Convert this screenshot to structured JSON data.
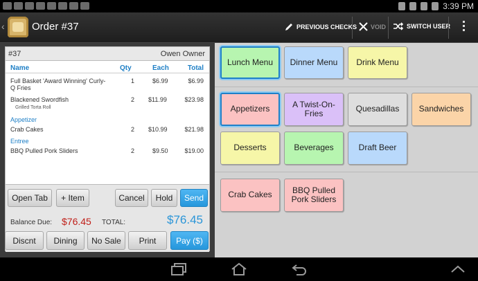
{
  "status": {
    "time": "3:39 PM",
    "notification_icons": [
      "usb-icon",
      "screenshot-icon",
      "play-store-icon",
      "play-store-icon",
      "play-store-icon",
      "play-store-icon",
      "play-store-icon",
      "play-store-icon"
    ],
    "system_icons": [
      "bluetooth-icon",
      "vibrate-icon",
      "wifi-icon",
      "battery-icon"
    ]
  },
  "actionbar": {
    "title": "Order #37",
    "previous_checks": "PREVIOUS CHECKS",
    "void": "VOID",
    "switch_user": "SWITCH USER"
  },
  "ticket": {
    "number": "#37",
    "owner": "Owen Owner",
    "columns": {
      "name": "Name",
      "qty": "Qty",
      "each": "Each",
      "total": "Total"
    },
    "items": [
      {
        "name": "Full Basket 'Award Winning' Curly-Q Fries",
        "qty": "1",
        "each": "$6.99",
        "total": "$6.99"
      },
      {
        "name": "Blackened Swordfish",
        "sub": "Grilled Torta Roll",
        "qty": "2",
        "each": "$11.99",
        "total": "$23.98"
      },
      {
        "category": "Appetizer"
      },
      {
        "name": "Crab Cakes",
        "qty": "2",
        "each": "$10.99",
        "total": "$21.98"
      },
      {
        "category": "Entree"
      },
      {
        "name": "BBQ Pulled Pork Sliders",
        "qty": "2",
        "each": "$9.50",
        "total": "$19.00"
      }
    ],
    "buttons": {
      "open_tab": "Open Tab",
      "add_item": "+ Item",
      "cancel": "Cancel",
      "hold": "Hold",
      "send": "Send"
    },
    "balance_label": "Balance Due:",
    "balance_value": "$76.45",
    "total_label": "TOTAL:",
    "total_value": "$76.45"
  },
  "footer_buttons": {
    "discount": "Discnt",
    "dining": "Dining",
    "no_sale": "No Sale",
    "print": "Print",
    "pay": "Pay ($)"
  },
  "menus": [
    {
      "label": "Lunch Menu",
      "color": "#b7f5b0",
      "selected": true
    },
    {
      "label": "Dinner Menu",
      "color": "#b9d9fb"
    },
    {
      "label": "Drink Menu",
      "color": "#f6f6a8"
    }
  ],
  "categories": [
    {
      "label": "Appetizers",
      "color": "#fbc2c2",
      "selected": true
    },
    {
      "label": "A Twist-On-Fries",
      "color": "#dac0f8"
    },
    {
      "label": "Quesadillas",
      "color": "#dedede"
    },
    {
      "label": "Sandwiches",
      "color": "#fbd4a8"
    },
    {
      "label": "Desserts",
      "color": "#f6f6a8"
    },
    {
      "label": "Beverages",
      "color": "#b7f5b0"
    },
    {
      "label": "Draft Beer",
      "color": "#b9d9fb"
    }
  ],
  "items": [
    {
      "label": "Crab Cakes",
      "color": "#fbc2c2"
    },
    {
      "label": "BBQ Pulled Pork Sliders",
      "color": "#fbc2c2"
    }
  ],
  "navbar": {
    "icons": [
      "recent-apps-icon",
      "home-icon",
      "back-icon",
      "menu-up-icon"
    ]
  }
}
